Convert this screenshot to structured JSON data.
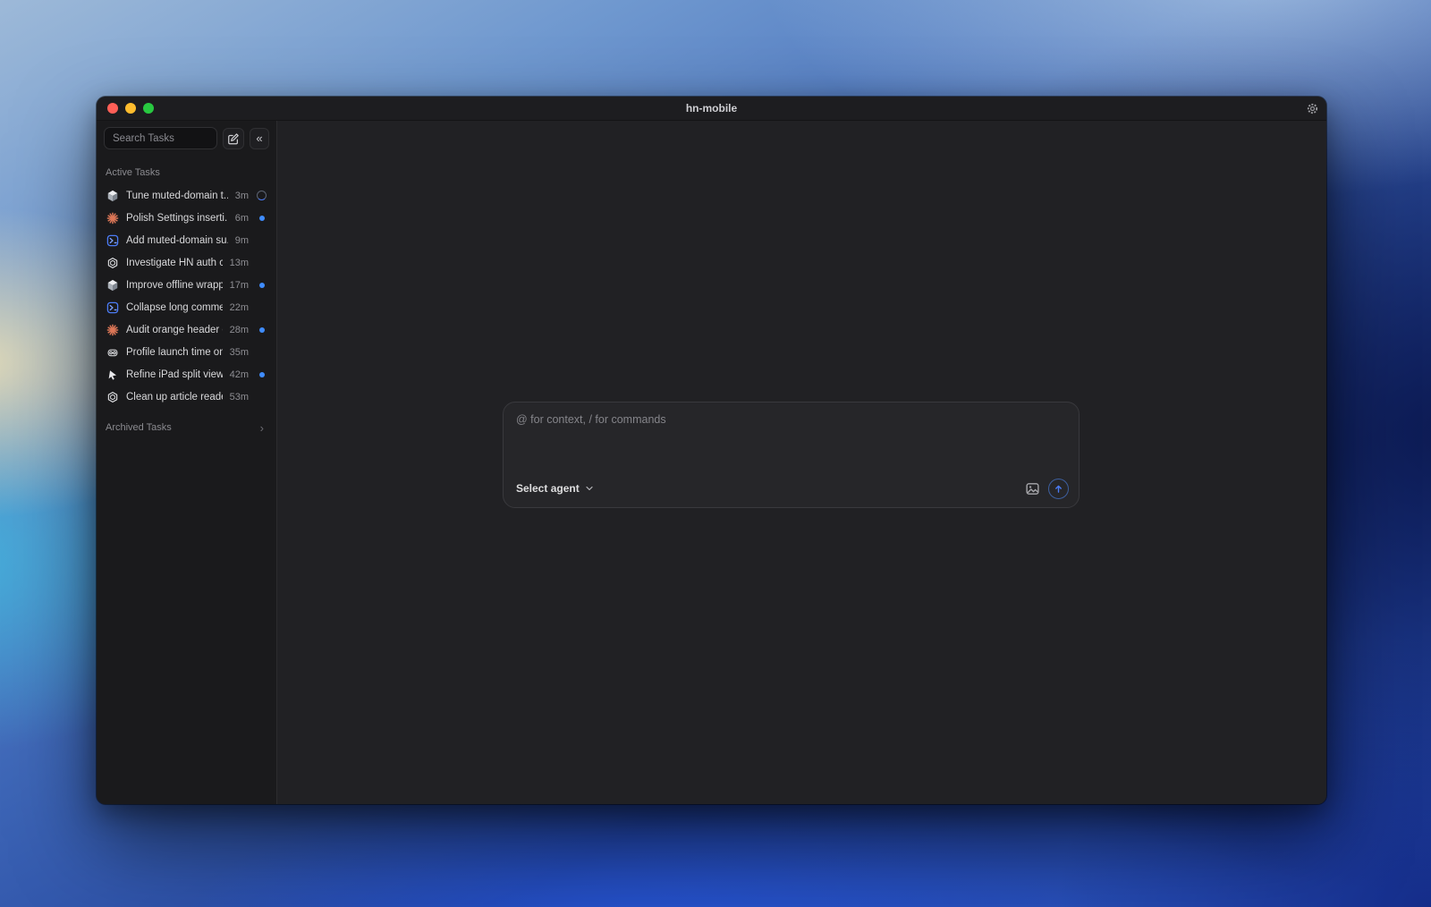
{
  "titlebar": {
    "title": "hn-mobile"
  },
  "sidebar": {
    "search_placeholder": "Search Tasks",
    "active_header": "Active Tasks",
    "archived_label": "Archived Tasks",
    "tasks": [
      {
        "title": "Tune muted-domain t...",
        "time": "3m",
        "agent": "cube",
        "status": "in-progress"
      },
      {
        "title": "Polish Settings inserti...",
        "time": "6m",
        "agent": "claude",
        "status": "unread"
      },
      {
        "title": "Add muted-domain su...",
        "time": "9m",
        "agent": "terminal",
        "status": "none"
      },
      {
        "title": "Investigate HN auth c...",
        "time": "13m",
        "agent": "openai",
        "status": "none"
      },
      {
        "title": "Improve offline wrapp...",
        "time": "17m",
        "agent": "cube",
        "status": "unread"
      },
      {
        "title": "Collapse long comme...",
        "time": "22m",
        "agent": "terminal",
        "status": "none"
      },
      {
        "title": "Audit orange header c...",
        "time": "28m",
        "agent": "claude",
        "status": "unread"
      },
      {
        "title": "Profile launch time on ...",
        "time": "35m",
        "agent": "robot",
        "status": "none"
      },
      {
        "title": "Refine iPad split view l...",
        "time": "42m",
        "agent": "cursor",
        "status": "unread"
      },
      {
        "title": "Clean up article reader...",
        "time": "53m",
        "agent": "openai",
        "status": "none"
      }
    ]
  },
  "composer": {
    "placeholder": "@ for context, / for commands",
    "select_agent_label": "Select agent"
  },
  "icons": {
    "collapse_glyph": "«",
    "archived_chevron": "›"
  },
  "colors": {
    "accent_blue": "#4b7bf5",
    "unread_dot": "#3f8cff",
    "claude_orange": "#dd7757",
    "traffic_red": "#ff5f57",
    "traffic_yellow": "#febc2e",
    "traffic_green": "#28c840"
  }
}
